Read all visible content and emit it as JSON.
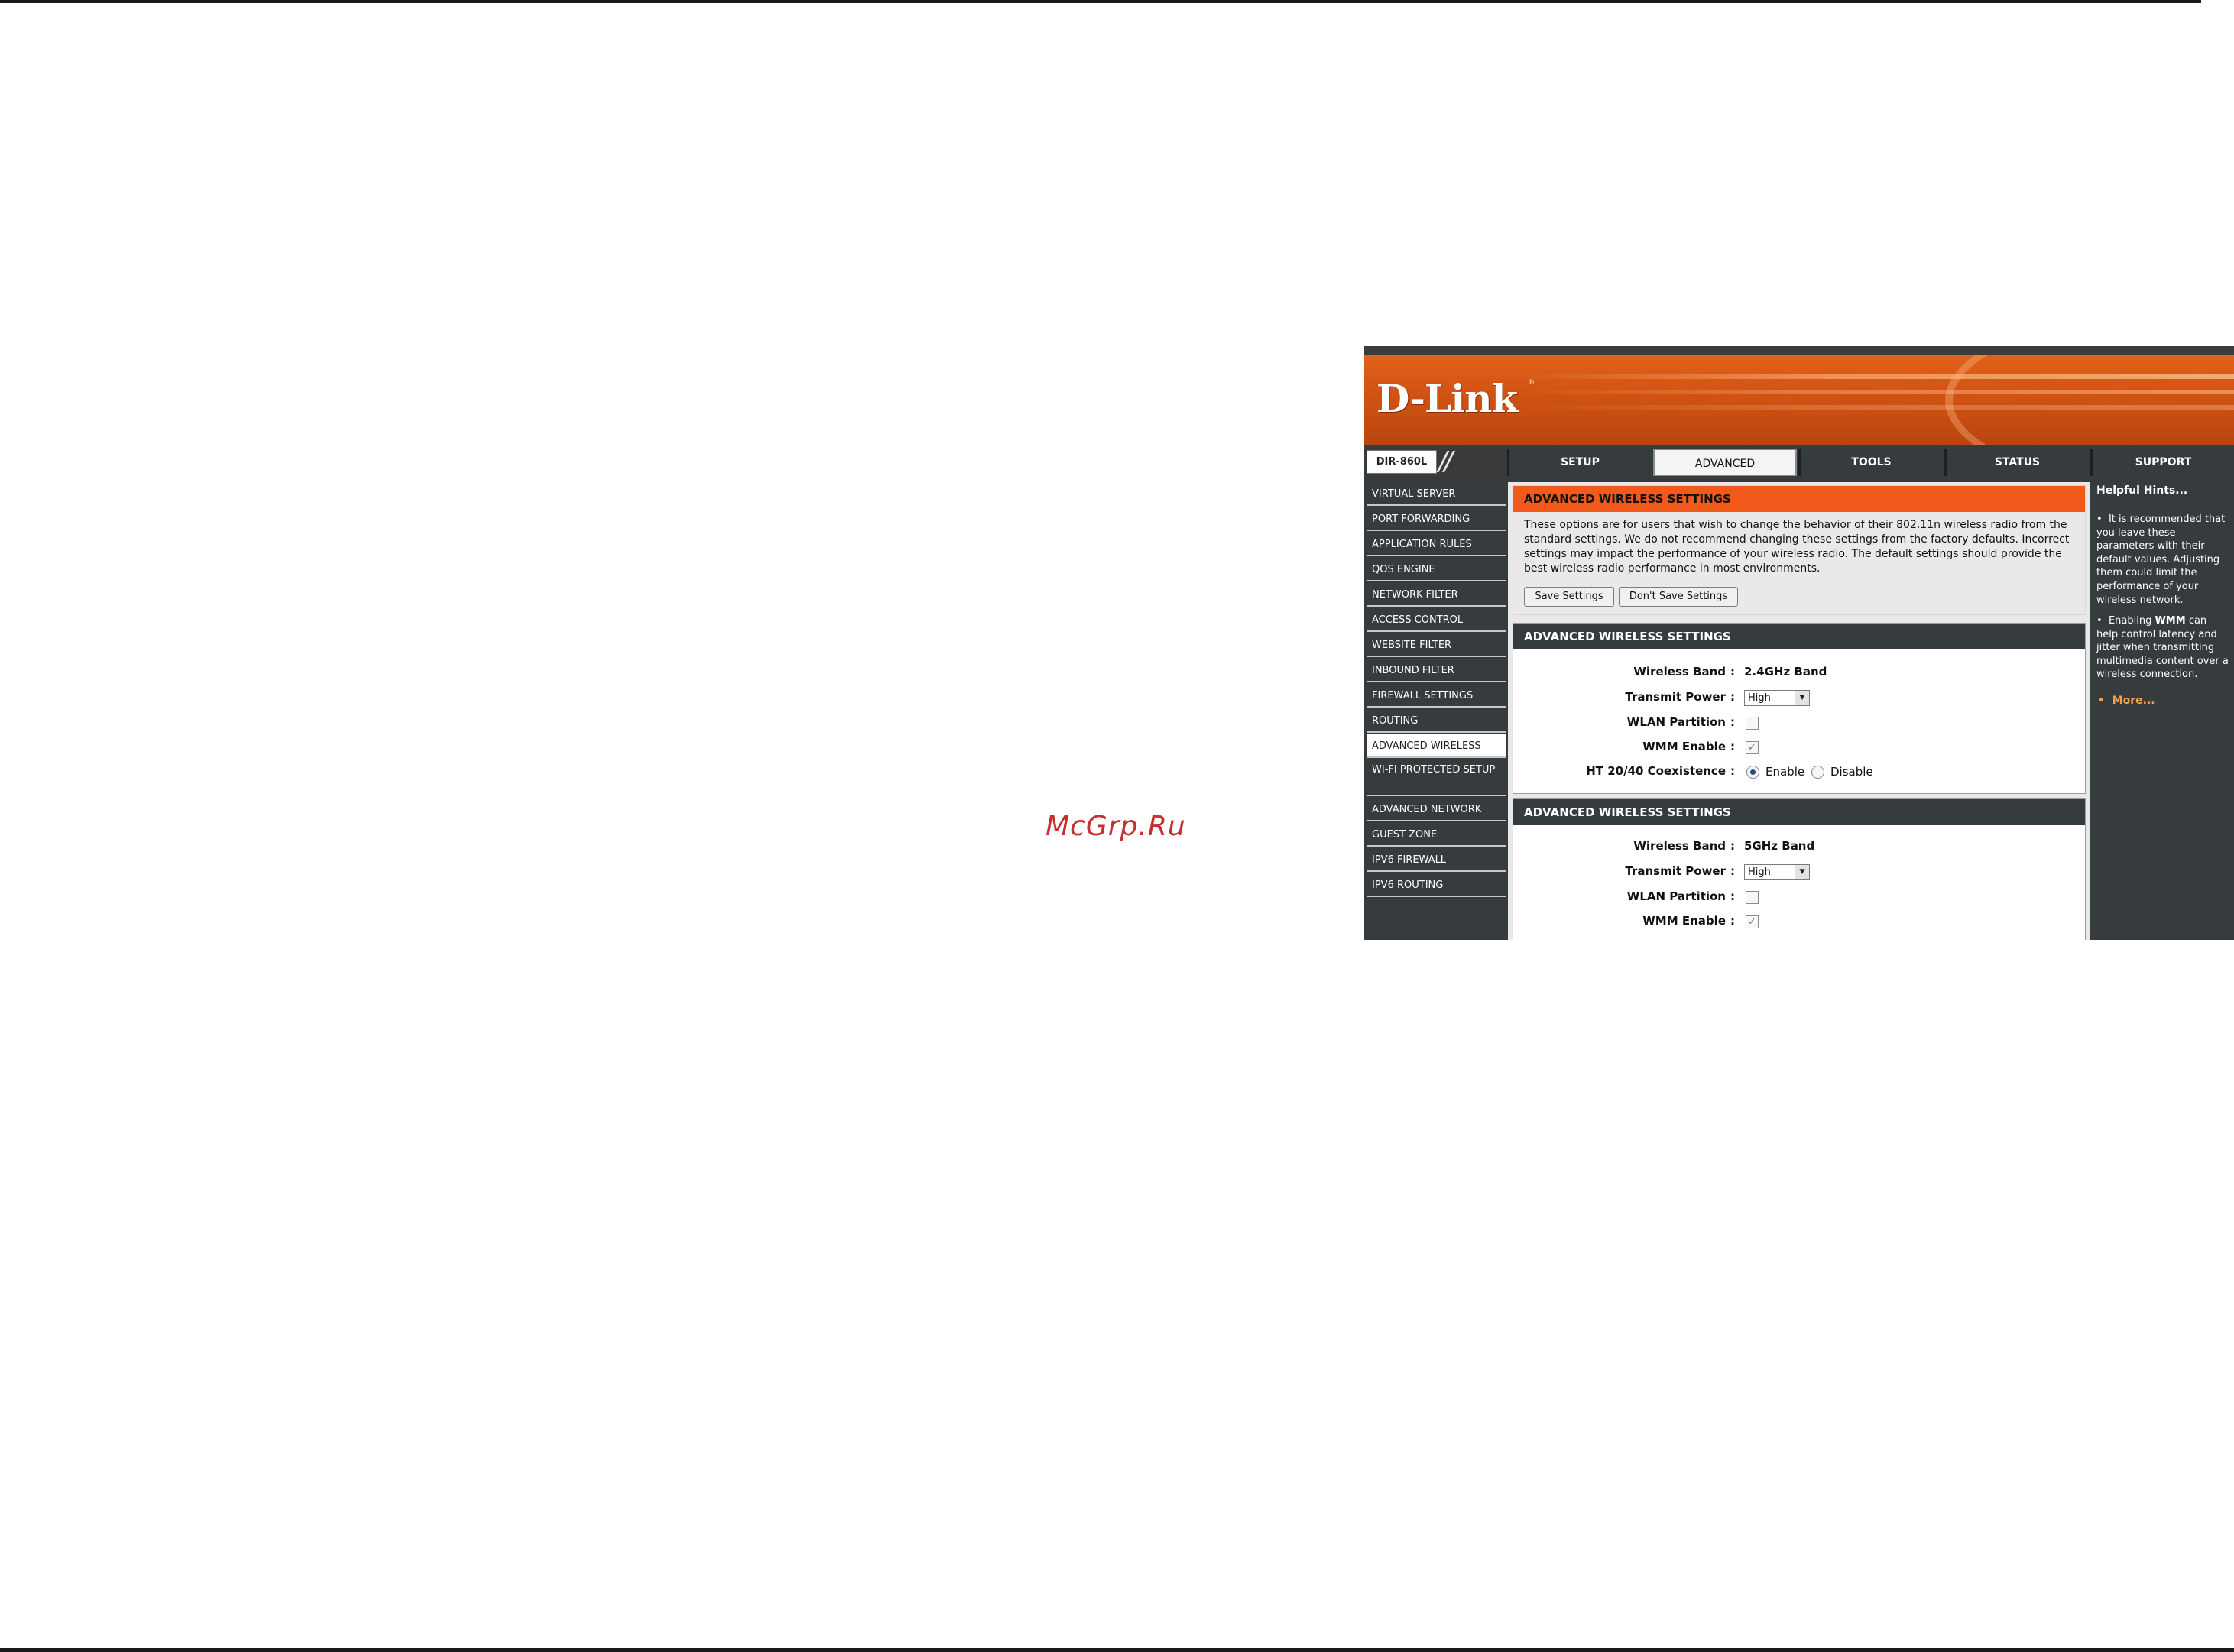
{
  "watermark": "McGrp.Ru",
  "router": {
    "brand": "D-Link",
    "model": "DIR-860L",
    "tabs": [
      "SETUP",
      "ADVANCED",
      "TOOLS",
      "STATUS",
      "SUPPORT"
    ],
    "active_tab": "ADVANCED",
    "sidebar": [
      "VIRTUAL SERVER",
      "PORT FORWARDING",
      "APPLICATION RULES",
      "QOS ENGINE",
      "NETWORK FILTER",
      "ACCESS CONTROL",
      "WEBSITE FILTER",
      "INBOUND FILTER",
      "FIREWALL SETTINGS",
      "ROUTING",
      "ADVANCED WIRELESS",
      "WI-FI PROTECTED SETUP",
      "ADVANCED NETWORK",
      "GUEST ZONE",
      "IPV6 FIREWALL",
      "IPV6 ROUTING"
    ],
    "active_sidebar": "ADVANCED WIRELESS",
    "intro": {
      "title": "ADVANCED WIRELESS SETTINGS",
      "text": "These options are for users that wish to change the behavior of their 802.11n wireless radio from the standard settings. We do not recommend changing these settings from the factory defaults. Incorrect settings may impact the performance of your wireless radio. The default settings should provide the best wireless radio performance in most environments.",
      "save_button": "Save Settings",
      "dont_save_button": "Don't Save Settings"
    },
    "panel_24": {
      "title": "ADVANCED WIRELESS SETTINGS",
      "wireless_band_label": "Wireless Band",
      "wireless_band_value": "2.4GHz Band",
      "transmit_power_label": "Transmit Power",
      "transmit_power_value": "High",
      "wlan_partition_label": "WLAN Partition",
      "wlan_partition_checked": false,
      "wmm_enable_label": "WMM Enable",
      "wmm_enable_checked": true,
      "ht_label": "HT 20/40 Coexistence",
      "ht_enable_label": "Enable",
      "ht_disable_label": "Disable",
      "ht_selected": "Enable"
    },
    "panel_5": {
      "title": "ADVANCED WIRELESS SETTINGS",
      "wireless_band_label": "Wireless Band",
      "wireless_band_value": "5GHz Band",
      "transmit_power_label": "Transmit Power",
      "transmit_power_value": "High",
      "wlan_partition_label": "WLAN Partition",
      "wlan_partition_checked": false,
      "wmm_enable_label": "WMM Enable",
      "wmm_enable_checked": true
    },
    "hints": {
      "title": "Helpful Hints...",
      "hint1": "It is recommended that you leave these parameters with their default values. Adjusting them could limit the performance of your wireless network.",
      "hint2_prefix": "Enabling ",
      "hint2_bold": "WMM",
      "hint2_suffix": " can help control latency and jitter when transmitting multimedia content over a wireless connection.",
      "more": "More..."
    },
    "colors": {
      "brand_orange": "#f15a1a",
      "dark_panel": "#363b3d",
      "link_orange": "#f4a14b"
    }
  }
}
